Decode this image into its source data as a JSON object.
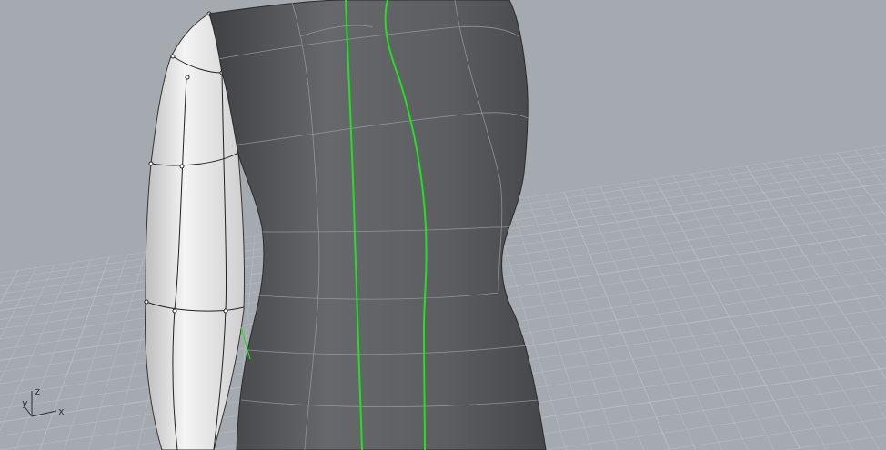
{
  "viewport": {
    "background": "#a5aab0",
    "grid_color": "#b8bcc2",
    "model_color": "#5a5c5f",
    "arm_color": "#e8e8e8",
    "curve_color": "#22e022"
  },
  "axis_widget": {
    "x_label": "x",
    "y_label": "y",
    "z_label": "z"
  }
}
